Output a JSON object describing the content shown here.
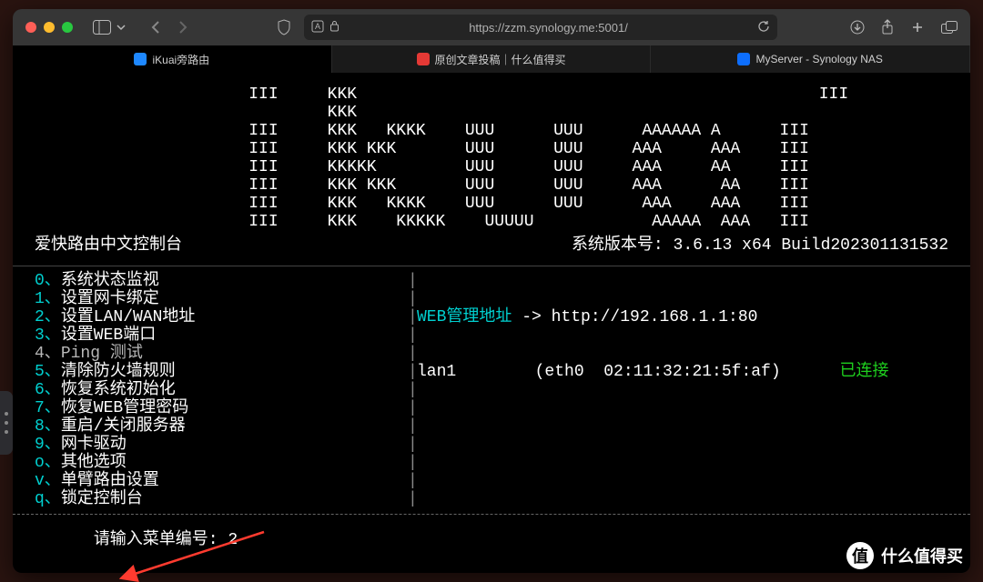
{
  "url": "https://zzm.synology.me:5001/",
  "tabs": [
    {
      "label": "iKuai旁路由"
    },
    {
      "label": "原创文章投稿｜什么值得买"
    },
    {
      "label": "MyServer - Synology NAS"
    }
  ],
  "ascii": [
    "                        III     KKK                                               III",
    "                                KKK",
    "                        III     KKK   KKKK    UUU      UUU      AAAAAA A      III",
    "                        III     KKK KKK       UUU      UUU     AAA     AAA    III",
    "                        III     KKKKK         UUU      UUU     AAA     AA     III",
    "                        III     KKK KKK       UUU      UUU     AAA      AA    III",
    "                        III     KKK   KKKK    UUU      UUU      AAA    AAA    III",
    "                        III     KKK    KKKKK    UUUUU            AAAAA  AAA   III"
  ],
  "header": {
    "left": "爱快路由中文控制台",
    "right": "系统版本号: 3.6.13 x64 Build202301131532"
  },
  "menu": [
    {
      "key": "0",
      "label": "系统状态监视"
    },
    {
      "key": "1",
      "label": "设置网卡绑定"
    },
    {
      "key": "2",
      "label": "设置LAN/WAN地址"
    },
    {
      "key": "3",
      "label": "设置WEB端口"
    },
    {
      "key": "4",
      "label": "Ping 测试"
    },
    {
      "key": "5",
      "label": "清除防火墙规则"
    },
    {
      "key": "6",
      "label": "恢复系统初始化"
    },
    {
      "key": "7",
      "label": "恢复WEB管理密码"
    },
    {
      "key": "8",
      "label": "重启/关闭服务器"
    },
    {
      "key": "9",
      "label": "网卡驱动"
    },
    {
      "key": "o",
      "label": "其他选项"
    },
    {
      "key": "v",
      "label": "单臂路由设置"
    },
    {
      "key": "q",
      "label": "锁定控制台"
    }
  ],
  "right": {
    "web_label": "WEB管理地址",
    "web_url": "http://192.168.1.1:80",
    "lan_line": "lan1        (eth0  02:11:32:21:5f:af)",
    "connected": "已连接"
  },
  "prompt": {
    "label": "请输入菜单编号: ",
    "value": "2"
  },
  "watermark": "什么值得买"
}
